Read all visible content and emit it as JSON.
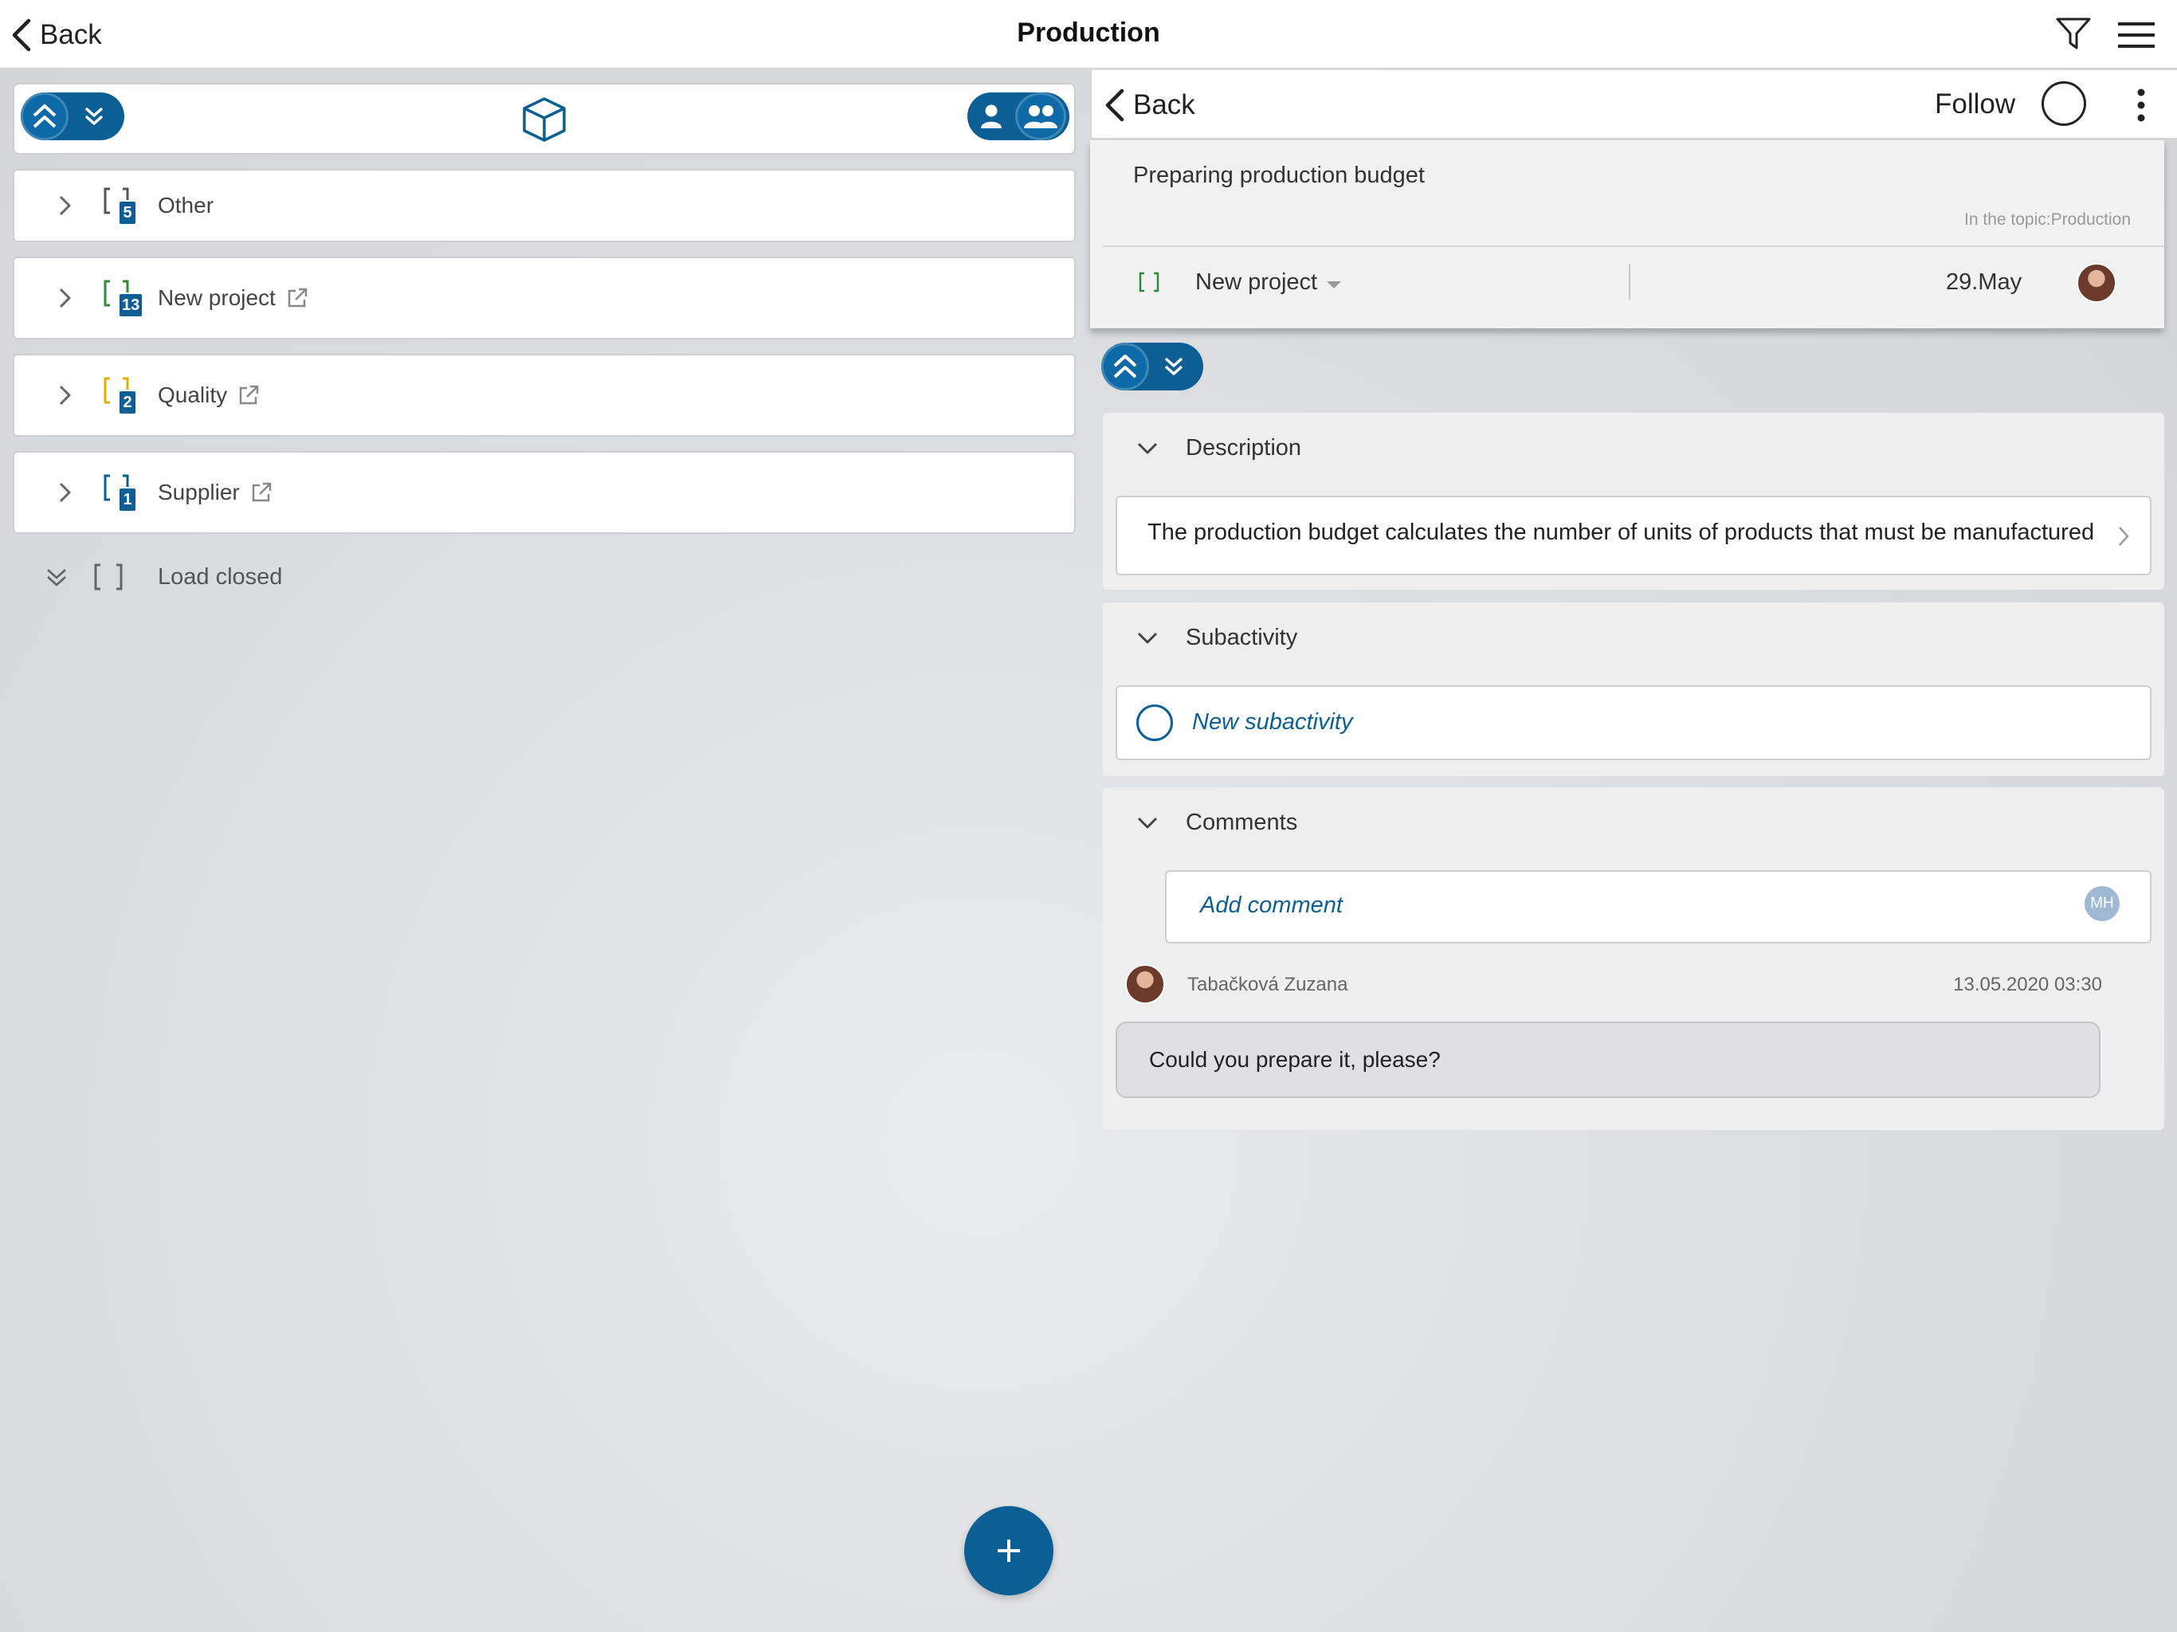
{
  "header": {
    "back_label": "Back",
    "title": "Production"
  },
  "left_panel": {
    "topics": [
      {
        "label": "Other",
        "count": "5",
        "bracket_color": "#555555",
        "external": false
      },
      {
        "label": "New project",
        "count": "13",
        "bracket_color": "#2e8b3a",
        "external": true
      },
      {
        "label": "Quality",
        "count": "2",
        "bracket_color": "#e0b000",
        "external": true
      },
      {
        "label": "Supplier",
        "count": "1",
        "bracket_color": "#0b5f94",
        "external": true
      }
    ],
    "load_closed_label": "Load closed"
  },
  "detail": {
    "back_label": "Back",
    "follow_label": "Follow",
    "task_title": "Preparing production budget",
    "topic_ref": "In the topic:Production",
    "project_name": "New project",
    "due_date": "29.May",
    "sections": {
      "description": {
        "title": "Description",
        "text": "The production budget calculates the number of units of products that must be manufactured"
      },
      "subactivity": {
        "title": "Subactivity",
        "new_placeholder": "New subactivity"
      },
      "comments": {
        "title": "Comments",
        "add_placeholder": "Add comment",
        "current_user_initials": "MH",
        "items": [
          {
            "author": "Tabačková Zuzana",
            "timestamp": "13.05.2020 03:30",
            "text": "Could you prepare it, please?"
          }
        ]
      }
    }
  },
  "colors": {
    "accent": "#0b5f94",
    "header_bg": "#ffffff",
    "panel_bg": "#efefef"
  },
  "icons": [
    "back-chevron-icon",
    "filter-icon",
    "hamburger-menu-icon",
    "collapse-all-icon",
    "expand-all-icon",
    "cube-icon",
    "single-user-icon",
    "group-users-icon",
    "chevron-right-icon",
    "external-link-icon",
    "double-chevron-down-icon",
    "plus-icon",
    "kebab-menu-icon",
    "caret-down-icon",
    "chevron-down-icon"
  ]
}
